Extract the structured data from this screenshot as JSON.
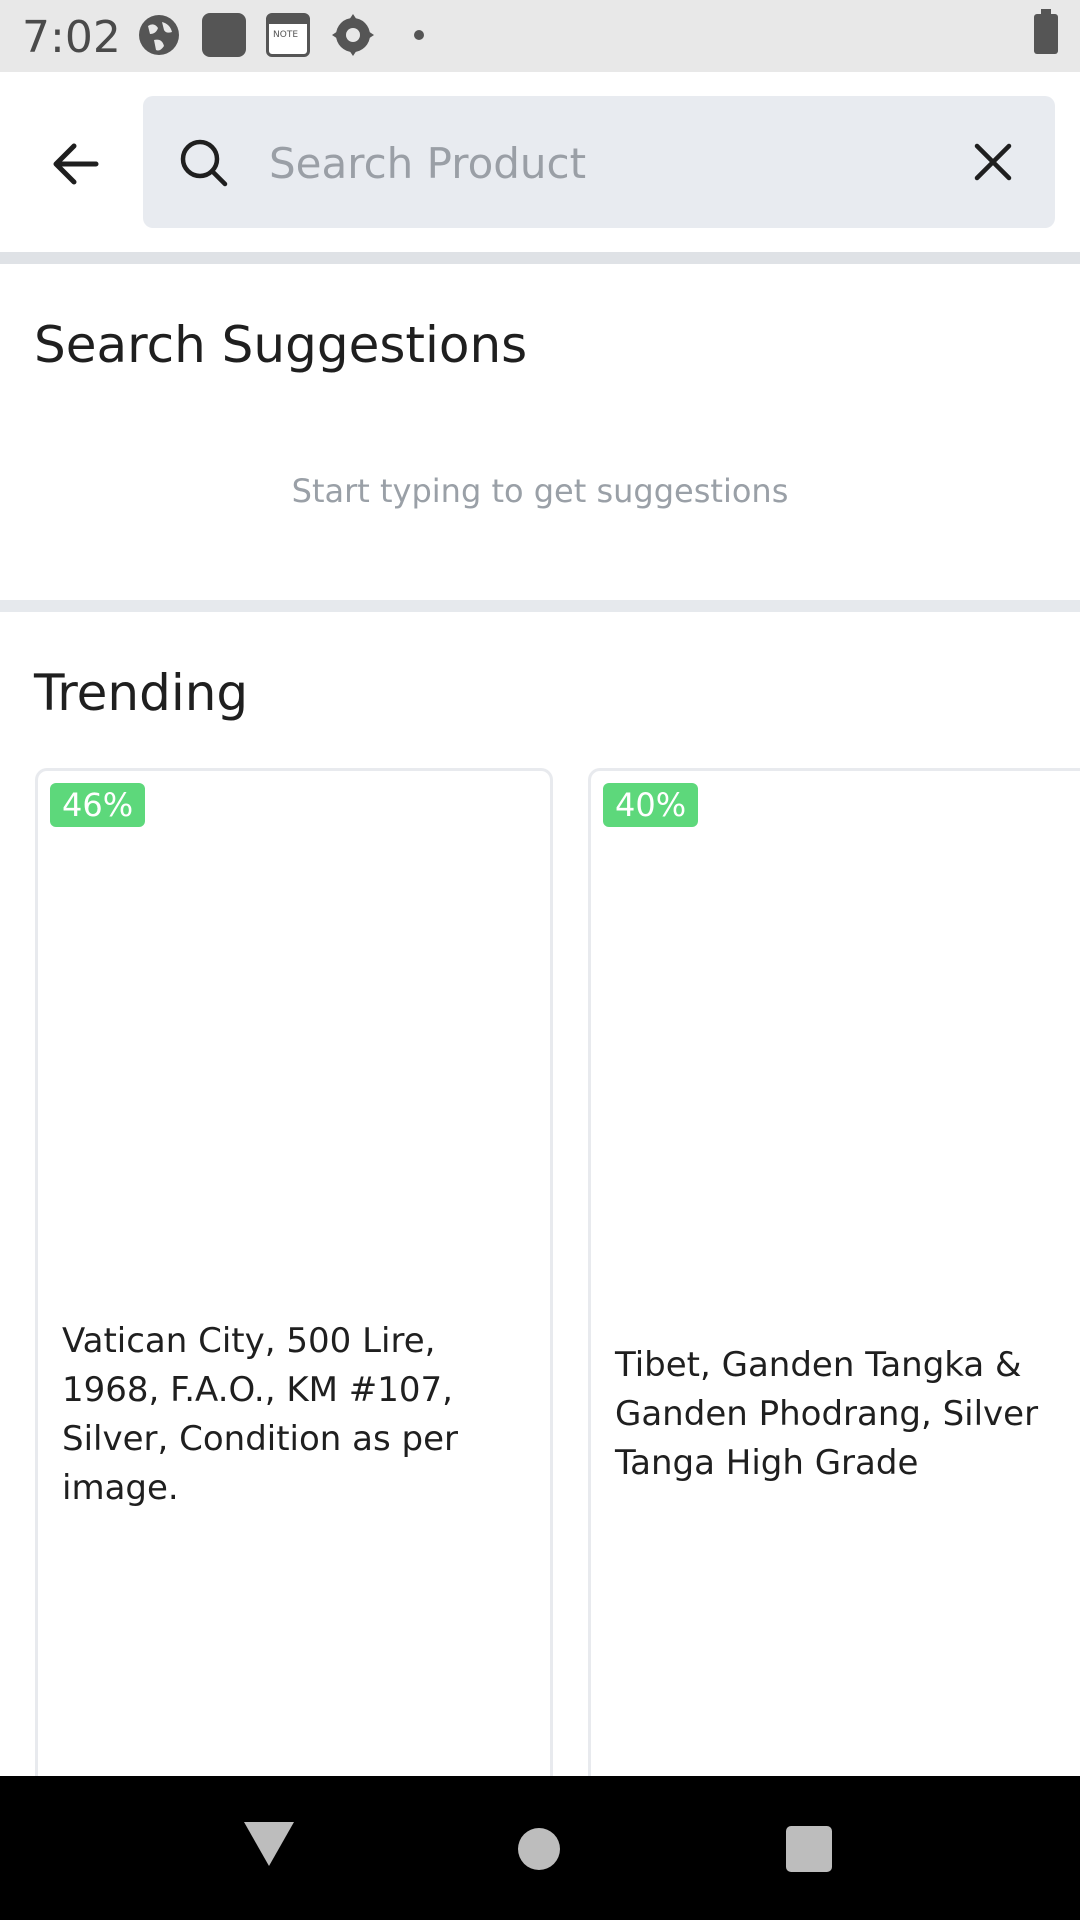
{
  "status_bar": {
    "time": "7:02",
    "icons": [
      "globe-icon",
      "app-icon",
      "note-icon",
      "gear-sync-icon",
      "dot-icon",
      "battery-charging-icon"
    ],
    "note_icon_text": "NOTE"
  },
  "search": {
    "placeholder": "Search Product",
    "value": ""
  },
  "suggestions": {
    "title": "Search Suggestions",
    "hint": "Start typing to get suggestions"
  },
  "trending": {
    "title": "Trending",
    "products": [
      {
        "discount": "46%",
        "name": "Vatican City, 500 Lire, 1968, F.A.O., KM #107, Silver, Condition as per image."
      },
      {
        "discount": "40%",
        "name": "Tibet, Ganden Tangka & Ganden Phodrang, Silver Tanga High Grade"
      }
    ]
  },
  "colors": {
    "badge": "#5dd87b",
    "search_bg": "#e8ebf0",
    "status_bar_bg": "#e8e8e8",
    "nav_bar_bg": "#000000"
  }
}
